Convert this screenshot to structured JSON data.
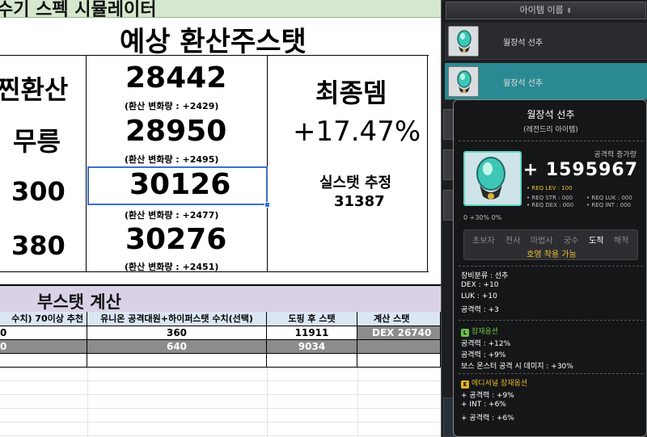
{
  "sheet": {
    "title_bar": "수기 스펙 시뮬레이터",
    "main_title": "예상 환산주스탯",
    "row_labels": [
      "찐환산",
      "무릉",
      "300",
      "380"
    ],
    "values": [
      "28442",
      "28950",
      "30126",
      "30276"
    ],
    "changes": [
      "(환산 변화량 : +2429)",
      "(환산 변화량 : +2495)",
      "(환산 변화량 : +2477)",
      "(환산 변화량 : +2451)"
    ],
    "final_label": "최종뎀",
    "final_value": "+17.47%",
    "real_label": "실스탯 추정",
    "real_value": "31387",
    "boost_title": "부스탯 계산",
    "columns": [
      "수치) 70이상 추천",
      "유니온 공격대원+하이퍼스탯 수치(선택)",
      "도핑 후 스탯",
      "계산 스탯"
    ],
    "rows": [
      [
        "0",
        "360",
        "11911",
        "DEX 26740"
      ],
      [
        "0",
        "640",
        "9034",
        ""
      ]
    ]
  },
  "panel": {
    "header": "아이템 이름",
    "items": [
      {
        "label": "월장석 선추"
      },
      {
        "label": "월장석 선추"
      }
    ]
  },
  "tooltip": {
    "name": "월장석 선추",
    "grade": "(레전드리 아이템)",
    "increase_label": "공격력 증가량",
    "increase_value": "+ 1595967",
    "req_lev": "• REQ LEV : 100",
    "req_str": "• REQ STR : 000",
    "req_luk": "• REQ LUK : 000",
    "req_dex": "• REQ DEX : 000",
    "req_int": "• REQ INT : 000",
    "small_icons": "0   +30%   0%",
    "jobs": [
      "초보자",
      "전사",
      "마법사",
      "궁수",
      "도적",
      "해적"
    ],
    "active_job": "도적",
    "job_note": "호영 착용 가능",
    "base": [
      "장비분류 : 선추",
      "DEX : +10",
      "LUK : +10",
      "공격력 : +3"
    ],
    "potential_title": "잠재옵션",
    "potential": [
      "공격력 : +12%",
      "공격력 : +9%",
      "보스 몬스터 공격 시 데미지 : +30%"
    ],
    "additional_title": "에디셔널 잠재옵션",
    "additional": [
      "+ 공격력 : +9%",
      "+ INT : +6%",
      "+ 공격력 : +6%"
    ],
    "colors": {
      "legendary": "#5ed9c6",
      "potential": "#6cc04a",
      "additional": "#e6b422"
    }
  }
}
